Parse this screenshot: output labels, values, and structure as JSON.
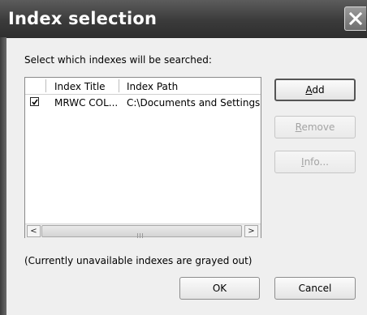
{
  "window": {
    "title": "Index selection"
  },
  "prompt": "Select which indexes will be searched:",
  "list": {
    "columns": [
      "Index Title",
      "Index Path"
    ],
    "rows": [
      {
        "checked": true,
        "title": "MRWC COL...",
        "path": "C:\\Documents and Settings\\"
      }
    ]
  },
  "buttons": {
    "add": {
      "accel": "A",
      "rest": "dd"
    },
    "remove": {
      "accel": "R",
      "rest": "emove"
    },
    "info": {
      "accel": "I",
      "rest": "nfo..."
    },
    "ok": "OK",
    "cancel": "Cancel"
  },
  "scroll": {
    "left_glyph": "<",
    "right_glyph": ">"
  },
  "note": "(Currently unavailable indexes are grayed out)",
  "colors": {
    "titlebar": "#3b3b3b",
    "dialog_bg": "#efefef",
    "disabled_text": "#a3a3a3"
  }
}
